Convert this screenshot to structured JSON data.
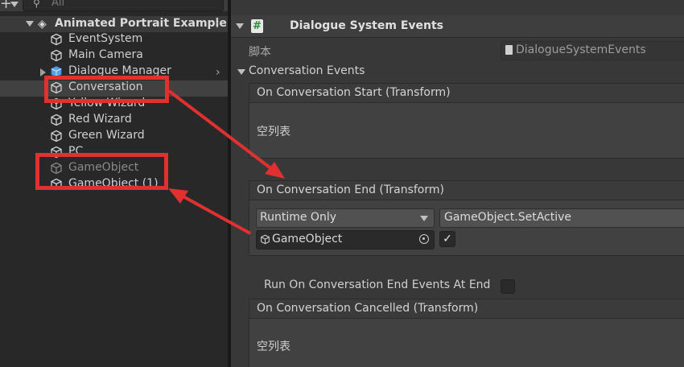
{
  "hierarchy": {
    "search_placeholder": "All",
    "scene_name": "Animated Portrait Example",
    "scene_menu": "⋮",
    "items": [
      {
        "label": "EventSystem"
      },
      {
        "label": "Main Camera"
      },
      {
        "label": "Dialogue Manager"
      },
      {
        "label": "Conversation"
      },
      {
        "label": "Yellow Wizard"
      },
      {
        "label": "Red Wizard"
      },
      {
        "label": "Green Wizard"
      },
      {
        "label": "PC"
      },
      {
        "label": "GameObject"
      },
      {
        "label": "GameObject (1)"
      }
    ]
  },
  "inspector": {
    "component_title": "Dialogue System Events",
    "script_badge": "#",
    "script_label": "脚本",
    "script_value": "DialogueSystemEvents",
    "conversation_events_label": "Conversation Events",
    "on_start": {
      "header": "On Conversation Start (Transform)",
      "empty_text": "空列表"
    },
    "on_end": {
      "header": "On Conversation End (Transform)",
      "call_state": "Runtime Only",
      "function": "GameObject.SetActive",
      "target": "GameObject",
      "bool_value": "✓"
    },
    "run_on_end_label": "Run On Conversation End Events At End",
    "on_cancelled": {
      "header": "On Conversation Cancelled (Transform)",
      "empty_text": "空列表"
    }
  },
  "colors": {
    "annotation": "#e03030",
    "panel_bg": "#383838",
    "hierarchy_bg": "#282828"
  }
}
